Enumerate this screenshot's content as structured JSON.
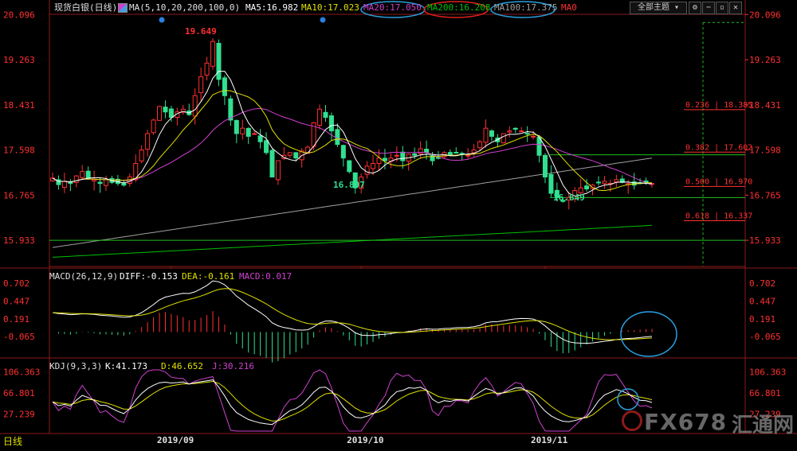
{
  "header": {
    "title": "现货白银(日线)",
    "ma_params": "MA(5,10,20,200,100,0)",
    "ma5": "MA5:16.982",
    "ma10": "MA10:17.023",
    "ma20": "MA20:17.050",
    "ma200": "MA200:16.208",
    "ma100": "MA100:17.375",
    "ma0": "MA0",
    "topic_button": "全部主题",
    "colors": {
      "ma5": "#ffffff",
      "ma10": "#e0e000",
      "ma20": "#d040d0",
      "ma200": "#00c000",
      "ma100": "#a0a0a0",
      "up": "#ff3030",
      "down": "#30e090",
      "axis": "#ff3030"
    }
  },
  "timeframe_label": "日线",
  "watermark": {
    "brand": "FX678",
    "cn": "汇通网"
  },
  "chart_data": [
    {
      "type": "candlestick",
      "name": "main",
      "y_ticks": [
        "20.096",
        "19.263",
        "18.431",
        "17.598",
        "16.765",
        "15.933"
      ],
      "ylim": [
        15.45,
        20.1
      ],
      "x_labels": [
        "2019/09",
        "2019/10",
        "2019/11"
      ],
      "annotations": {
        "high": "19.649",
        "low1": "16.897",
        "low2": "16.649"
      },
      "fib_levels": [
        {
          "label": "0.236 | 18.385",
          "value": 18.385
        },
        {
          "label": "0.382 | 17.602",
          "value": 17.602
        },
        {
          "label": "0.500 | 16.970",
          "value": 16.97
        },
        {
          "label": "0.618 | 16.337",
          "value": 16.337
        }
      ],
      "horizontal_lines": [
        17.51,
        16.72,
        15.933
      ],
      "closes": [
        17.08,
        16.96,
        17.02,
        16.98,
        17.12,
        17.2,
        17.08,
        17.05,
        16.98,
        17.05,
        17.0,
        16.98,
        16.95,
        17.1,
        17.35,
        17.6,
        17.9,
        18.15,
        18.4,
        18.3,
        18.2,
        18.3,
        18.35,
        18.25,
        18.6,
        18.95,
        19.2,
        19.6,
        18.9,
        18.6,
        18.15,
        17.9,
        18.0,
        17.85,
        17.9,
        17.75,
        17.55,
        17.1,
        17.4,
        17.5,
        17.55,
        17.45,
        17.58,
        17.65,
        18.1,
        18.35,
        18.2,
        17.95,
        17.7,
        17.45,
        17.2,
        16.9,
        17.1,
        17.3,
        17.35,
        17.45,
        17.4,
        17.45,
        17.5,
        17.4,
        17.52,
        17.5,
        17.62,
        17.55,
        17.4,
        17.45,
        17.55,
        17.5,
        17.55,
        17.52,
        17.5,
        17.6,
        17.75,
        18.0,
        17.85,
        17.75,
        17.9,
        17.95,
        17.98,
        17.95,
        17.9,
        17.85,
        17.5,
        17.1,
        16.8,
        16.72,
        16.65,
        16.72,
        16.85,
        16.9,
        16.88,
        16.95,
        17.0,
        17.02,
        16.98,
        17.05,
        17.0,
        16.98,
        16.95,
        16.98,
        17.0,
        16.98
      ]
    },
    {
      "type": "macd",
      "name": "MACD",
      "params": "MACD(26,12,9)",
      "diff_label": "DIFF:-0.153",
      "dea_label": "DEA:-0.161",
      "macd_label": "MACD:0.017",
      "y_ticks": [
        "0.702",
        "0.447",
        "0.191",
        "-0.065"
      ],
      "ylim": [
        -0.35,
        0.75
      ]
    },
    {
      "type": "kdj",
      "name": "KDJ",
      "params": "KDJ(9,3,3)",
      "k_label": "K:41.173",
      "d_label": "D:46.652",
      "j_label": "J:30.216",
      "y_ticks": [
        "106.363",
        "66.801",
        "27.239"
      ],
      "ylim": [
        -5,
        110
      ]
    }
  ]
}
